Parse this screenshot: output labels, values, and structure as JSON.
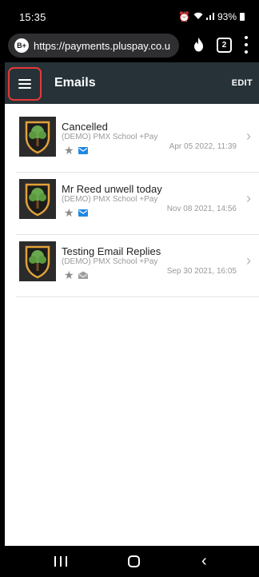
{
  "status_bar": {
    "time": "15:35",
    "battery": "93%"
  },
  "browser": {
    "site_badge": "B+",
    "url": "https://payments.pluspay.co.u",
    "tab_count": "2"
  },
  "app_bar": {
    "title": "Emails",
    "edit_label": "EDIT"
  },
  "emails": [
    {
      "subject": "Cancelled",
      "sender": "(DEMO) PMX School +Pay",
      "date": "Apr 05 2022, 11:39",
      "read": false
    },
    {
      "subject": "Mr Reed unwell today",
      "sender": "(DEMO) PMX School +Pay",
      "date": "Nov 08 2021, 14:56",
      "read": false
    },
    {
      "subject": "Testing Email Replies",
      "sender": "(DEMO) PMX School +Pay",
      "date": "Sep 30 2021, 16:05",
      "read": true
    }
  ],
  "colors": {
    "app_bar": "#263238",
    "highlight": "#e53935",
    "unread_envelope": "#1e88e5",
    "read_envelope": "#9e9e9e"
  }
}
